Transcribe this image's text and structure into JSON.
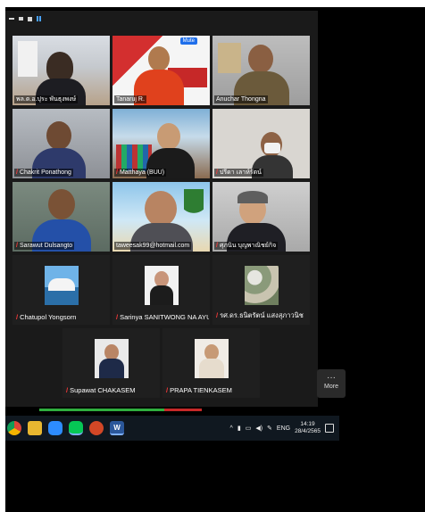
{
  "meeting": {
    "mute_badge": "Mute",
    "more_label": "More",
    "more_dots": "···"
  },
  "video_tiles": [
    {
      "name": "พล.ต.อ.ปุระ พันธุงพงษ์",
      "muted": false
    },
    {
      "name": "Tanaruj R.",
      "muted": false
    },
    {
      "name": "Anuchar Thongna",
      "muted": false
    },
    {
      "name": "Chakrit Ponathong",
      "muted": true
    },
    {
      "name": "Matthaya (BUU)",
      "muted": true
    },
    {
      "name": "ปรีดา เลาห์รัตน์",
      "muted": true
    },
    {
      "name": "Sarawut Dulsangto",
      "muted": true
    },
    {
      "name": "taweesak99@hotmail.com",
      "muted": false
    },
    {
      "name": "ศุภนิน บุญพาณิชย์กิจ",
      "muted": true
    }
  ],
  "avatar_tiles": [
    {
      "name": "Chatupol Yongsorn",
      "muted": true
    },
    {
      "name": "Sarinya SANITWONG NA AYUTT...",
      "muted": true
    },
    {
      "name": "รศ.ดร.ธนิตรัตน์ แสงสุภาวนิช",
      "muted": true
    },
    {
      "name": "Supawat CHAKASEM",
      "muted": true
    },
    {
      "name": "PRAPA TIENKASEM",
      "muted": true
    }
  ],
  "taskbar": {
    "lang": "ENG",
    "time": "14:19",
    "date": "28/4/2565",
    "icons": [
      "chrome-icon",
      "file-explorer-icon",
      "zoom-icon",
      "line-icon",
      "powerpoint-icon",
      "word-icon"
    ]
  },
  "colors": {
    "active_speaker": "#a8d64b",
    "mic_muted": "#ff3b3b",
    "progress_green": "#2fae3e",
    "progress_red": "#c62828"
  }
}
